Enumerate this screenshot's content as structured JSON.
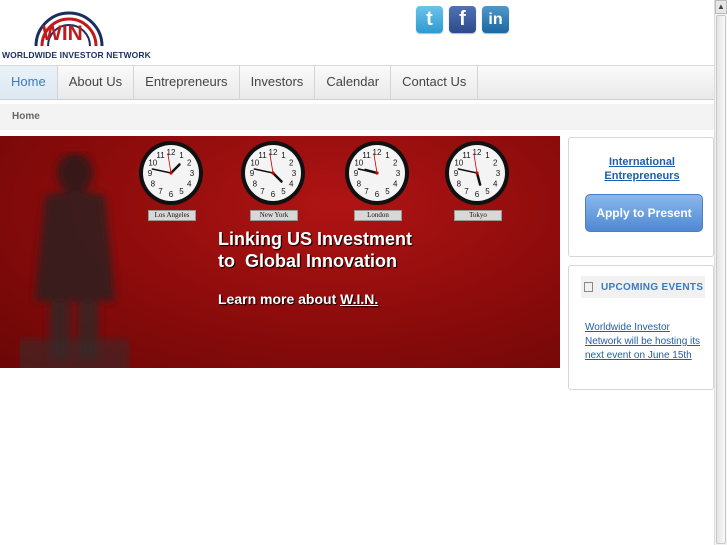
{
  "logo": {
    "mark": "WIN",
    "name": "WORLDWIDE INVESTOR NETWORK"
  },
  "social": [
    {
      "name": "twitter",
      "glyph": "t"
    },
    {
      "name": "facebook",
      "glyph": "f"
    },
    {
      "name": "linkedin",
      "glyph": "in"
    }
  ],
  "nav": {
    "items": [
      {
        "label": "Home",
        "active": true
      },
      {
        "label": "About Us"
      },
      {
        "label": "Entrepreneurs"
      },
      {
        "label": "Investors"
      },
      {
        "label": "Calendar"
      },
      {
        "label": "Contact Us"
      }
    ]
  },
  "breadcrumb": {
    "current": "Home"
  },
  "banner": {
    "clocks": [
      {
        "city": "Los Angeles",
        "hour": 1.5,
        "minute": 47
      },
      {
        "city": "New York",
        "hour": 4.5,
        "minute": 47
      },
      {
        "city": "London",
        "hour": 9.5,
        "minute": 47
      },
      {
        "city": "Tokyo",
        "hour": 5.5,
        "minute": 47
      }
    ],
    "tagline_line1": "Linking US Investment",
    "tagline_line2": "to  Global Innovation",
    "learn_prefix": "Learn more about ",
    "learn_link": "W.I.N."
  },
  "sidebar": {
    "intl_line1": "International",
    "intl_line2": "Entrepreneurs",
    "apply_label": "Apply to Present",
    "events_title": "UPCOMING EVENTS",
    "events_text": "Worldwide Investor Network will be hosting its next event on June 15th"
  },
  "colors": {
    "brand_red": "#c01a1a",
    "nav_active": "#3b7bbf",
    "link": "#1f5ea8"
  }
}
